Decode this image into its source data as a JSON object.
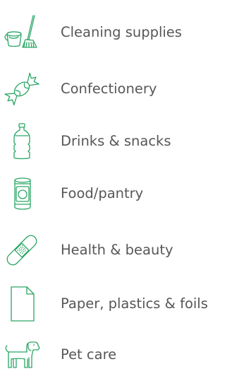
{
  "accent_color": "#2aa665",
  "text_color": "#575757",
  "categories": [
    {
      "label": "Cleaning supplies",
      "icon": "bucket-mop-icon"
    },
    {
      "label": "Confectionery",
      "icon": "wrapped-candy-icon"
    },
    {
      "label": "Drinks & snacks",
      "icon": "bottle-icon"
    },
    {
      "label": "Food/pantry",
      "icon": "tin-can-icon"
    },
    {
      "label": "Health & beauty",
      "icon": "bandage-icon"
    },
    {
      "label": "Paper, plastics & foils",
      "icon": "paper-sheet-icon"
    },
    {
      "label": "Pet care",
      "icon": "dog-icon"
    }
  ]
}
